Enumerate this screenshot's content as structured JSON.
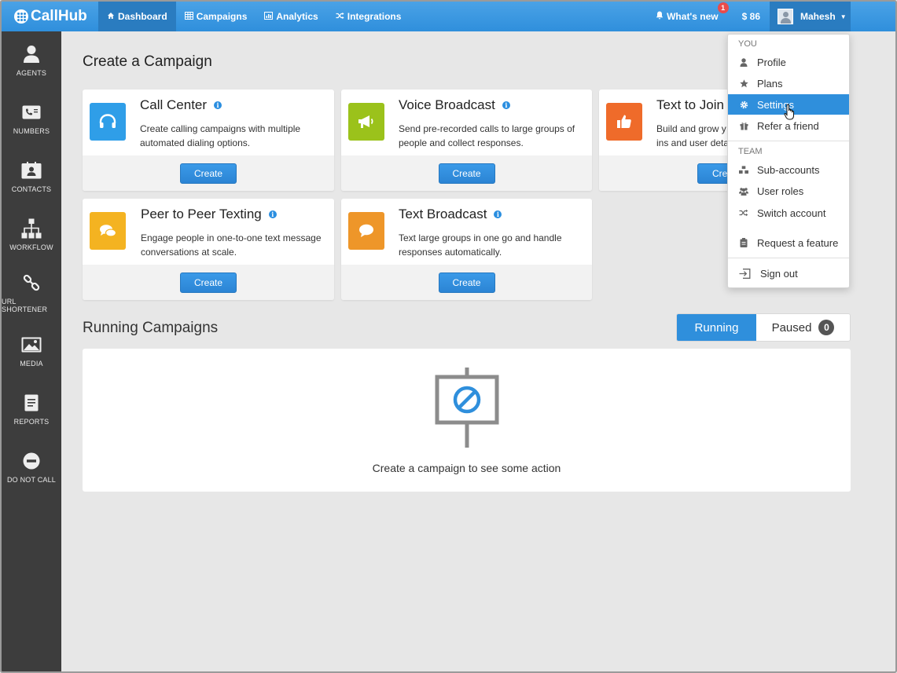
{
  "brand": {
    "name": "CallHub"
  },
  "nav": [
    {
      "label": "Dashboard",
      "icon": "home-icon",
      "active": true
    },
    {
      "label": "Campaigns",
      "icon": "grid-icon",
      "active": false
    },
    {
      "label": "Analytics",
      "icon": "bar-chart-icon",
      "active": false
    },
    {
      "label": "Integrations",
      "icon": "shuffle-icon",
      "active": false
    }
  ],
  "topbar": {
    "whats_new": "What's new",
    "whats_new_count": "1",
    "credit": "$ 86",
    "user_name": "Mahesh"
  },
  "sidebar": [
    {
      "label": "AGENTS",
      "icon": "person-icon"
    },
    {
      "label": "NUMBERS",
      "icon": "phone-card-icon"
    },
    {
      "label": "CONTACTS",
      "icon": "contact-card-icon"
    },
    {
      "label": "WORKFLOW",
      "icon": "hierarchy-icon"
    },
    {
      "label": "URL SHORTENER",
      "icon": "link-icon"
    },
    {
      "label": "MEDIA",
      "icon": "image-icon"
    },
    {
      "label": "REPORTS",
      "icon": "document-icon"
    },
    {
      "label": "DO NOT CALL",
      "icon": "minus-circle-icon"
    }
  ],
  "create": {
    "title": "Create a Campaign",
    "cards": [
      {
        "title": "Call Center",
        "desc": "Create calling campaigns with multiple automated dialing options.",
        "button": "Create",
        "color": "#2f9ee8",
        "icon": "headset-icon"
      },
      {
        "title": "Voice Broadcast",
        "desc": "Send pre-recorded calls to large groups of people and collect responses.",
        "button": "Create",
        "color": "#9bc21b",
        "icon": "megaphone-icon"
      },
      {
        "title": "Text to Join",
        "desc": "Build and grow y ins and user deta",
        "button": "Crea",
        "color": "#ef6b2a",
        "icon": "thumbs-up-icon"
      },
      {
        "title": "Peer to Peer Texting",
        "desc": "Engage people in one-to-one text message conversations at scale.",
        "button": "Create",
        "color": "#f4b321",
        "icon": "chat-bubbles-icon"
      },
      {
        "title": "Text Broadcast",
        "desc": "Text large groups in one go and handle responses automatically.",
        "button": "Create",
        "color": "#ee9629",
        "icon": "speech-bubble-icon"
      }
    ]
  },
  "running": {
    "title": "Running Campaigns",
    "tab_running": "Running",
    "tab_paused": "Paused",
    "paused_count": "0",
    "empty_message": "Create a campaign to see some action"
  },
  "menu": {
    "section_you": "YOU",
    "section_team": "TEAM",
    "items": [
      {
        "label": "Profile",
        "icon": "person-icon"
      },
      {
        "label": "Plans",
        "icon": "star-icon"
      },
      {
        "label": "Settings",
        "icon": "gear-icon"
      },
      {
        "label": "Refer a friend",
        "icon": "gift-icon"
      },
      {
        "label": "Sub-accounts",
        "icon": "sitemap-icon"
      },
      {
        "label": "User roles",
        "icon": "users-icon"
      },
      {
        "label": "Switch account",
        "icon": "shuffle-icon"
      },
      {
        "label": "Request a feature",
        "icon": "clipboard-icon"
      },
      {
        "label": "Sign out",
        "icon": "sign-out-icon"
      }
    ]
  }
}
